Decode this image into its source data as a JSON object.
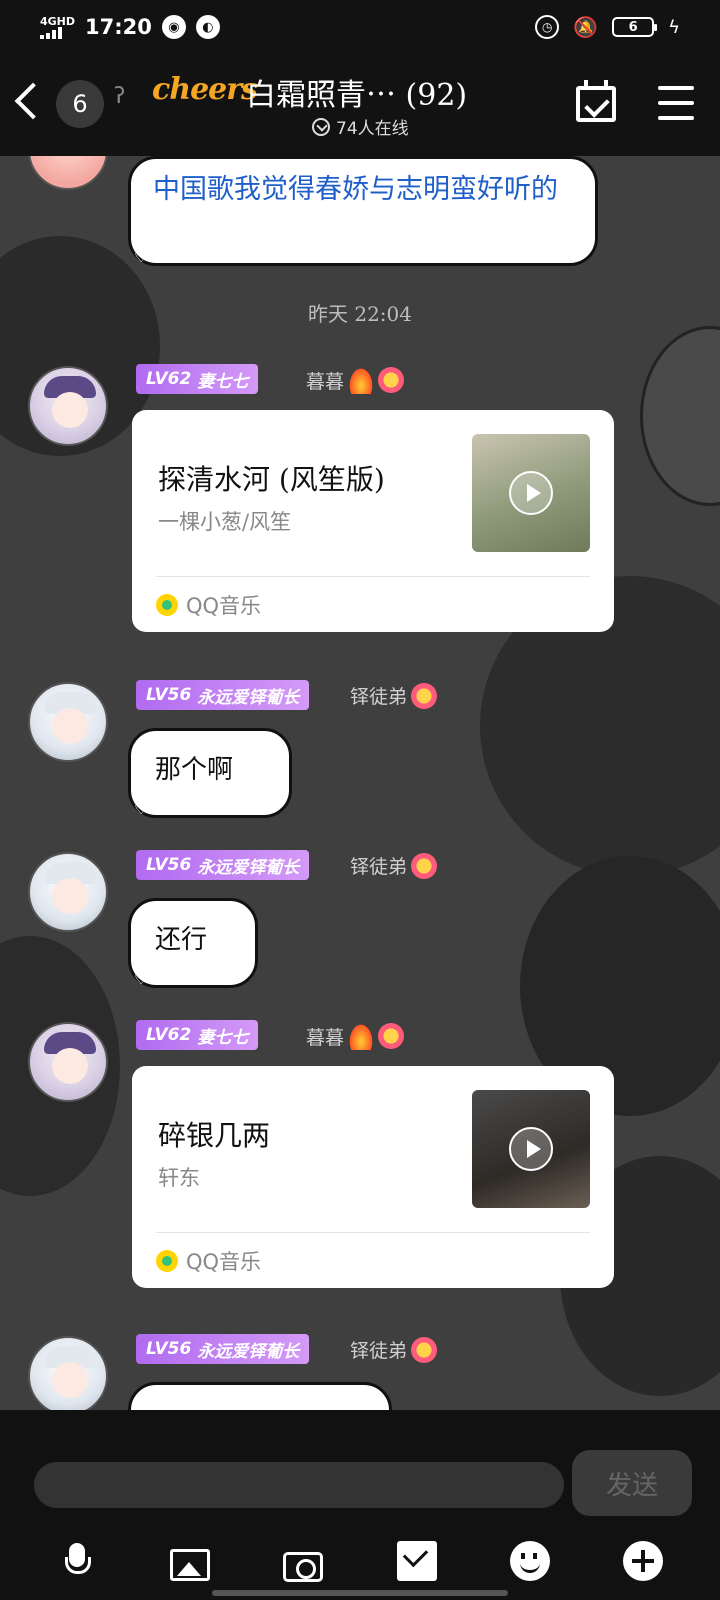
{
  "status_bar": {
    "network": "4GHD",
    "time": "17:20",
    "battery": "6"
  },
  "header": {
    "unread_count": "6",
    "logo_text": "cheers",
    "group_title": "白霜照青⋯ (92)",
    "online_text": "74人在线"
  },
  "chat": {
    "messages": [
      {
        "type": "text",
        "text": "中国歌我觉得春娇与志明蛮好听的"
      },
      {
        "type": "timestamp",
        "text": "昨天 22:04"
      },
      {
        "type": "music",
        "level": "LV62",
        "title_tag": "妻七七",
        "username": "暮暮",
        "song_title": "探清水河 (风笙版)",
        "artist": "一棵小葱/风笙",
        "source": "QQ音乐"
      },
      {
        "type": "text",
        "level": "LV56",
        "title_tag": "永远爱铎葡长",
        "username": "铎徒弟",
        "text": "那个啊"
      },
      {
        "type": "text",
        "level": "LV56",
        "title_tag": "永远爱铎葡长",
        "username": "铎徒弟",
        "text": "还行"
      },
      {
        "type": "music",
        "level": "LV62",
        "title_tag": "妻七七",
        "username": "暮暮",
        "song_title": "碎银几两",
        "artist": "轩东",
        "source": "QQ音乐"
      },
      {
        "type": "text",
        "level": "LV56",
        "title_tag": "永远爱铎葡长",
        "username": "铎徒弟",
        "text": ""
      }
    ]
  },
  "input_bar": {
    "send_label": "发送"
  },
  "icons": [
    "mic-icon",
    "image-icon",
    "camera-icon",
    "red-packet-icon",
    "emoji-icon",
    "plus-icon"
  ],
  "colors": {
    "accent": "#f5a623",
    "level_badge": "#b06bf0",
    "link_blue": "#1f5fc9"
  }
}
